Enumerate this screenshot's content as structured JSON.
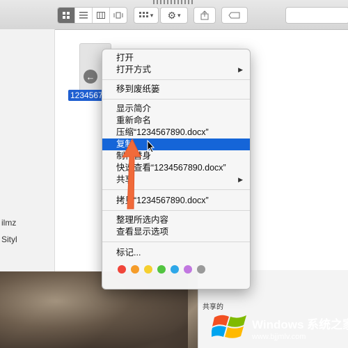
{
  "toolbar": {
    "view_icons": [
      "icon-view-icon",
      "list-view-icon",
      "column-view-icon",
      "gallery-view-icon"
    ],
    "arrange_icon": "arrange-grid-icon",
    "action_icon": "gear-icon",
    "chevron": "▾"
  },
  "file": {
    "name": "1234567"
  },
  "sidebar": {
    "items": [
      "ilmz",
      "Sityl"
    ]
  },
  "context_menu": {
    "items": [
      {
        "label": "打开",
        "has_submenu": false
      },
      {
        "label": "打开方式",
        "has_submenu": true
      },
      {
        "label": "移到废纸篓",
        "has_submenu": false
      },
      {
        "label": "显示简介",
        "has_submenu": false
      },
      {
        "label": "重新命名",
        "has_submenu": false
      },
      {
        "label": "压缩“1234567890.docx”",
        "has_submenu": false
      },
      {
        "label": "复制",
        "has_submenu": false,
        "selected": true
      },
      {
        "label": "制作替身",
        "has_submenu": false
      },
      {
        "label": "快速查看“1234567890.docx”",
        "has_submenu": false
      },
      {
        "label": "共享",
        "has_submenu": true
      },
      {
        "label": "拷贝“1234567890.docx”",
        "has_submenu": false
      },
      {
        "label": "整理所选内容",
        "has_submenu": false
      },
      {
        "label": "查看显示选项",
        "has_submenu": false
      },
      {
        "label": "标记...",
        "has_submenu": false
      }
    ],
    "submenu_arrow": "▶",
    "tag_colors": [
      "#f0453a",
      "#f59c2a",
      "#f5cf2f",
      "#52c440",
      "#2ea7e8",
      "#c177e0",
      "#9a9a9a"
    ]
  },
  "share_panel": {
    "label": "共享的"
  },
  "watermark": {
    "brand": "Windows 系统之家",
    "url": "www.bjjmlv.com"
  },
  "colors": {
    "selection": "#1565d8",
    "annotation_arrow": "#f06a3a"
  }
}
